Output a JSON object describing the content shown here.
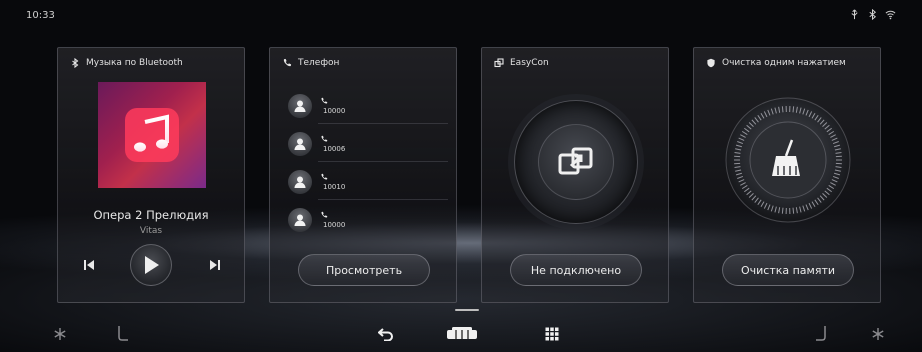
{
  "status_bar": {
    "time": "10:33",
    "icons": [
      "usb-icon",
      "bluetooth-icon",
      "wifi-icon"
    ]
  },
  "cards": {
    "bluetooth_music": {
      "title": "Музыка по Bluetooth",
      "icon": "bluetooth-icon",
      "song_title": "Опера 2 Прелюдия",
      "artist": "Vitas",
      "controls": [
        "prev-icon",
        "play-icon",
        "next-icon"
      ]
    },
    "phone": {
      "title": "Телефон",
      "icon": "phone-icon",
      "contacts": [
        {
          "number": "10000"
        },
        {
          "number": "10006"
        },
        {
          "number": "10010"
        },
        {
          "number": "10000"
        }
      ],
      "button_label": "Просмотреть"
    },
    "easycon": {
      "title": "EasyCon",
      "icon": "easycon-icon",
      "button_label": "Не подключено"
    },
    "clean": {
      "title": "Очистка одним нажатием",
      "icon": "shield-icon",
      "button_label": "Очистка памяти"
    }
  },
  "dock": {
    "items": [
      "climate-left-icon",
      "seat-left-icon",
      "back-icon",
      "car-home-icon",
      "app-grid-icon",
      "seat-right-icon",
      "climate-right-icon"
    ]
  },
  "colors": {
    "background": "#000000",
    "card_border": "#96969f",
    "text": "#e6e6e6",
    "album_accent": "#c2304a"
  }
}
